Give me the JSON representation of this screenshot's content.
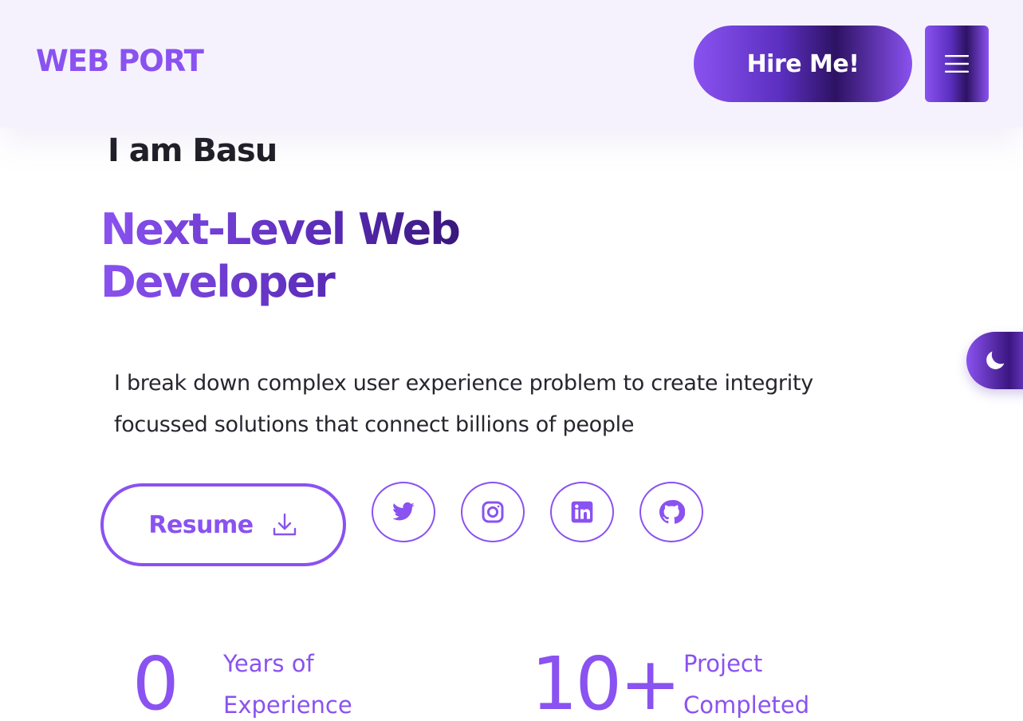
{
  "header": {
    "logo": "WEB PORT",
    "hire_button": "Hire Me!",
    "menu_icon": "hamburger-menu-icon"
  },
  "hero": {
    "greeting": "I am Basu",
    "headline_line1": "Next-Level Web",
    "headline_line2": "Developer",
    "intro_line1": "I break down complex user experience problem to create integrity",
    "intro_line2": "focussed solutions that connect billions of people",
    "resume_button": "Resume",
    "resume_icon": "download-icon"
  },
  "social_links": [
    "twitter-icon",
    "instagram-icon",
    "linkedin-icon",
    "github-icon"
  ],
  "theme_toggle_icon": "moon-icon",
  "stats": {
    "experience": {
      "value": "0",
      "label_line1": "Years of",
      "label_line2": "Experience"
    },
    "projects": {
      "value": "10+",
      "label_line1": "Project",
      "label_line2": "Completed"
    }
  },
  "colors": {
    "accent": "#8a52f0",
    "accent_dark": "#2d1263",
    "header_bg": "#f5f2fd",
    "text": "#1e1e24"
  }
}
